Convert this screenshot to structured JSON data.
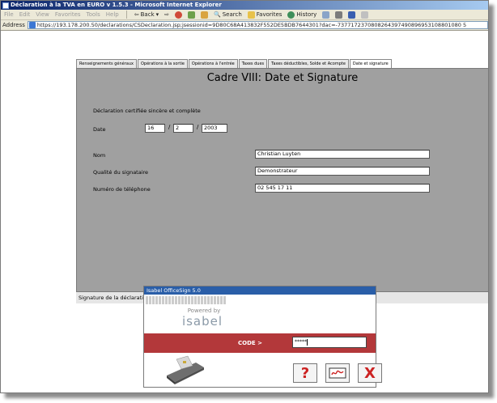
{
  "window": {
    "title": "Déclaration à la TVA en EURO v 1.5.3 - Microsoft Internet Explorer"
  },
  "menubar": {
    "items": [
      "File",
      "Edit",
      "View",
      "Favorites",
      "Tools",
      "Help"
    ],
    "back_label": "Back",
    "search_label": "Search",
    "favorites_label": "Favorites",
    "history_label": "History"
  },
  "address": {
    "label": "Address",
    "url": "https://193.178.200.50/declarations/CSDeclaration.jsp;jsessionid=9D80C68A413832F552DE5BDB7644301?dac=-7377172370808264397490896953108801080 5"
  },
  "tabs": [
    {
      "label": "Renseignements généraux",
      "active": false
    },
    {
      "label": "Opérations à la sortie",
      "active": false
    },
    {
      "label": "Opérations à l'entrée",
      "active": false
    },
    {
      "label": "Taxes dues",
      "active": false
    },
    {
      "label": "Taxes déductibles, Solde et Acompte",
      "active": false
    },
    {
      "label": "Date et signature",
      "active": true
    }
  ],
  "panel": {
    "title": "Cadre VIII: Date et Signature",
    "certified_text": "Déclaration certifiée sincère et complète",
    "date_label": "Date",
    "date_day": "16",
    "date_month": "2",
    "date_year": "2003",
    "date_sep": "/",
    "name_label": "Nom",
    "name_value": "Christian Luyten",
    "quality_label": "Qualité du signataire",
    "quality_value": "Demonstrateur",
    "phone_label": "Numéro de téléphone",
    "phone_value": "02 545 17 11"
  },
  "status": {
    "text": "Signature de la déclaration..."
  },
  "dialog": {
    "title": "Isabel OfficeSign 5.0",
    "powered_by": "Powered by",
    "brand": "isabel",
    "code_label": "CODE >",
    "code_value": "*****",
    "help_symbol": "?",
    "cancel_symbol": "X"
  },
  "colors": {
    "panel_bg": "#a0a0a0",
    "dialog_band": "#b3383a",
    "dialog_title_bg": "#2a5ea8",
    "help_red": "#cc2222",
    "cancel_red": "#cc2222"
  }
}
